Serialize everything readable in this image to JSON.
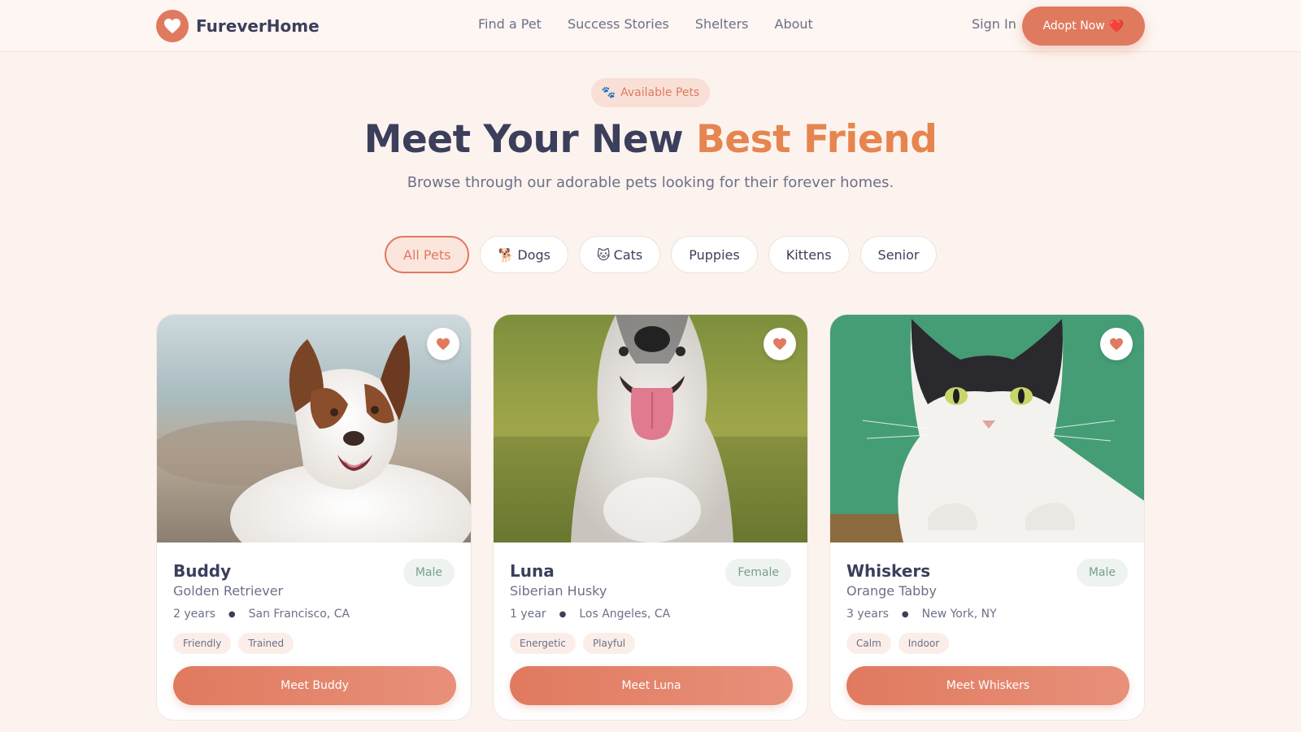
{
  "brand": {
    "name": "FureverHome",
    "icon": "heart-icon"
  },
  "nav": [
    "Find a Pet",
    "Success Stories",
    "Shelters",
    "About"
  ],
  "header": {
    "sign_in": "Sign In",
    "adopt_label": "Adopt Now",
    "adopt_emoji": "❤️"
  },
  "hero": {
    "badge_icon": "🐾",
    "badge": "Available Pets",
    "title_main": "Meet Your New ",
    "title_accent": "Best Friend",
    "subtitle": "Browse through our adorable pets looking for their forever homes."
  },
  "filters": [
    {
      "label": "All Pets",
      "icon": "",
      "active": true
    },
    {
      "label": "Dogs",
      "icon": "🐕",
      "active": false
    },
    {
      "label": "Cats",
      "icon": "🐱",
      "active": false
    },
    {
      "label": "Puppies",
      "icon": "",
      "active": false
    },
    {
      "label": "Kittens",
      "icon": "",
      "active": false
    },
    {
      "label": "Senior",
      "icon": "",
      "active": false
    }
  ],
  "pets": [
    {
      "name": "Buddy",
      "gender": "Male",
      "breed": "Golden Retriever",
      "age": "2 years",
      "location": "San Francisco, CA",
      "tags": [
        "Friendly",
        "Trained"
      ],
      "button": "Meet Buddy",
      "photo": "dog-photo"
    },
    {
      "name": "Luna",
      "gender": "Female",
      "breed": "Siberian Husky",
      "age": "1 year",
      "location": "Los Angeles, CA",
      "tags": [
        "Energetic",
        "Playful"
      ],
      "button": "Meet Luna",
      "photo": "husky-photo"
    },
    {
      "name": "Whiskers",
      "gender": "Male",
      "breed": "Orange Tabby",
      "age": "3 years",
      "location": "New York, NY",
      "tags": [
        "Calm",
        "Indoor"
      ],
      "button": "Meet Whiskers",
      "photo": "cat-photo"
    }
  ],
  "colors": {
    "accent": "#e07a5f",
    "title_accent": "#e6854f",
    "text": "#3b3f5c",
    "background": "#fdf3ee"
  }
}
